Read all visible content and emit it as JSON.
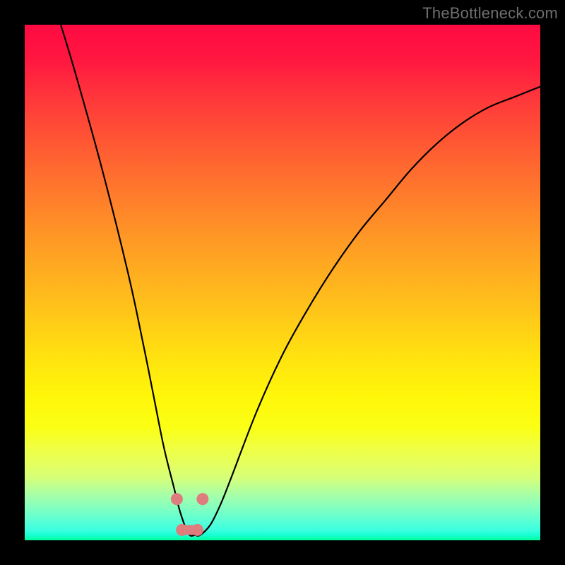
{
  "attribution": "TheBottleneck.com",
  "chart_data": {
    "type": "line",
    "title": "",
    "xlabel": "",
    "ylabel": "",
    "xlim": [
      0,
      100
    ],
    "ylim": [
      0,
      100
    ],
    "grid": false,
    "legend": false,
    "series": [
      {
        "name": "bottleneck-curve",
        "x": [
          7,
          10,
          15,
          20,
          23,
          25,
          27,
          29,
          30,
          31,
          32,
          33,
          34,
          36,
          38,
          40,
          45,
          50,
          55,
          60,
          65,
          70,
          75,
          80,
          85,
          90,
          95,
          100
        ],
        "values": [
          100,
          90,
          72,
          52,
          38,
          28,
          18,
          10,
          6,
          3,
          1,
          1,
          1,
          3,
          7,
          12,
          25,
          36,
          45,
          53,
          60,
          66,
          72,
          77,
          81,
          84,
          86,
          88
        ]
      }
    ],
    "markers": [
      {
        "x": 29.5,
        "y": 8
      },
      {
        "x": 34.5,
        "y": 8
      },
      {
        "x": 30.5,
        "y": 2
      },
      {
        "x": 33.5,
        "y": 2
      }
    ],
    "marker_segment": {
      "x1": 30.5,
      "y1": 2,
      "x2": 33.5,
      "y2": 2
    }
  }
}
